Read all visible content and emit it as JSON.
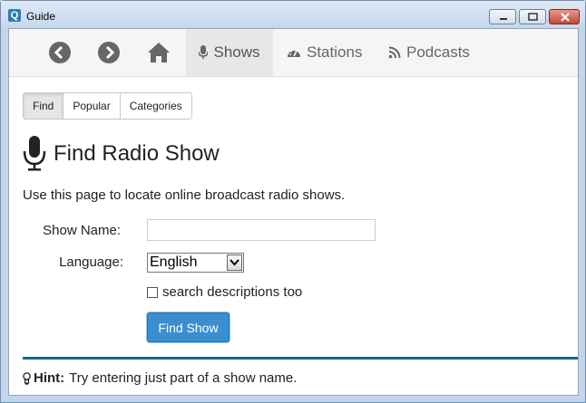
{
  "window": {
    "title": "Guide"
  },
  "nav": {
    "items": [
      {
        "label": "Shows",
        "icon": "microphone-icon",
        "active": true
      },
      {
        "label": "Stations",
        "icon": "dashboard-icon"
      },
      {
        "label": "Podcasts",
        "icon": "rss-icon"
      }
    ]
  },
  "tabs": [
    "Find",
    "Popular",
    "Categories"
  ],
  "page": {
    "title": "Find Radio Show",
    "intro": "Use this page to locate online broadcast radio shows."
  },
  "form": {
    "show_name_label": "Show Name:",
    "show_name_value": "",
    "language_label": "Language:",
    "language_value": "English",
    "search_desc_label": "search descriptions too",
    "submit_label": "Find Show"
  },
  "hint": {
    "label": "Hint:",
    "text": "Try entering just part of a show name."
  },
  "colors": {
    "accent": "#3a8fd0",
    "rule": "#0e6b8c"
  }
}
